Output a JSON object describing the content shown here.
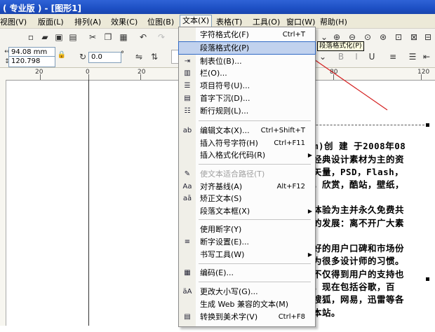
{
  "window": {
    "title": "( 专业版 ) - [图形1]"
  },
  "menubar": [
    {
      "label": "视图(V)"
    },
    {
      "label": "版面(L)"
    },
    {
      "label": "排列(A)"
    },
    {
      "label": "效果(C)"
    },
    {
      "label": "位图(B)"
    },
    {
      "label": "文本(X)"
    },
    {
      "label": "表格(T)"
    },
    {
      "label": "工具(O)"
    },
    {
      "label": "窗口(W)"
    },
    {
      "label": "帮助(H)"
    }
  ],
  "property_bar": {
    "x_value": "94.08 mm",
    "y_value": "120.798 mm",
    "rotation": "0.0",
    "degree_symbol": "°"
  },
  "ruler": {
    "labels": [
      "20",
      "0",
      "20",
      "40",
      "60",
      "80",
      "120"
    ]
  },
  "tooltip": "段落格式化(P)",
  "text_menu": {
    "items": [
      {
        "label": "字符格式化(F)",
        "shortcut": "Ctrl+T",
        "icon": "character-format-icon",
        "glyph": ""
      },
      {
        "label": "段落格式化(P)",
        "shortcut": "",
        "icon": "paragraph-format-icon",
        "glyph": "",
        "highlighted": true
      },
      {
        "label": "制表位(B)...",
        "shortcut": "",
        "icon": "tab-stops-icon",
        "glyph": "⇥"
      },
      {
        "label": "栏(O)...",
        "shortcut": "",
        "icon": "columns-icon",
        "glyph": "▥"
      },
      {
        "label": "项目符号(U)...",
        "shortcut": "",
        "icon": "bullets-icon",
        "glyph": "☰"
      },
      {
        "label": "首字下沉(D)...",
        "shortcut": "",
        "icon": "drop-cap-icon",
        "glyph": "▤"
      },
      {
        "label": "断行规则(L)...",
        "shortcut": "",
        "icon": "line-break-rules-icon",
        "glyph": "☷"
      },
      {
        "label": "编辑文本(X)...",
        "shortcut": "Ctrl+Shift+T",
        "icon": "edit-text-icon",
        "glyph": "ab",
        "sep_before": true
      },
      {
        "label": "插入符号字符(H)",
        "shortcut": "Ctrl+F11",
        "icon": "insert-symbol-icon",
        "glyph": ""
      },
      {
        "label": "插入格式化代码(R)",
        "shortcut": "",
        "icon": "",
        "glyph": "",
        "submenu": true
      },
      {
        "label": "使文本适合路径(T)",
        "shortcut": "",
        "icon": "fit-text-path-icon",
        "glyph": "✎",
        "disabled": true,
        "sep_before": true
      },
      {
        "label": "对齐基线(A)",
        "shortcut": "Alt+F12",
        "icon": "align-baseline-icon",
        "glyph": "Aa"
      },
      {
        "label": "矫正文本(S)",
        "shortcut": "",
        "icon": "straighten-text-icon",
        "glyph": "aā"
      },
      {
        "label": "段落文本框(X)",
        "shortcut": "",
        "icon": "",
        "glyph": "",
        "submenu": true
      },
      {
        "label": "使用断字(Y)",
        "shortcut": "",
        "icon": "",
        "glyph": "",
        "sep_before": true
      },
      {
        "label": "断字设置(E)...",
        "shortcut": "",
        "icon": "hyphenation-icon",
        "glyph": "≡"
      },
      {
        "label": "书写工具(W)",
        "shortcut": "",
        "icon": "",
        "glyph": "",
        "submenu": true
      },
      {
        "label": "编码(E)...",
        "shortcut": "",
        "icon": "encoding-icon",
        "glyph": "▦",
        "sep_before": true
      },
      {
        "label": "更改大小写(G)...",
        "shortcut": "",
        "icon": "change-case-icon",
        "glyph": "äA",
        "sep_before": true
      },
      {
        "label": "生成 Web 兼容的文本(M)",
        "shortcut": "",
        "icon": "",
        "glyph": ""
      },
      {
        "label": "转换到美术字(V)",
        "shortcut": "Ctrl+F8",
        "icon": "convert-artistic-icon",
        "glyph": "▤"
      }
    ]
  },
  "document_text": [
    "m)创 建 于2008年08",
    "经典设计素材为主的资",
    "矢量，PSD，Flash，",
    "，欣赏，酷站，壁纸，",
    "",
    "体验为主并永久免费共",
    "的发展：离不开广大素",
    "",
    "好的用户口碑和市场份",
    "为很多设计师的习惯。",
    "不仅得到用户的支持也",
    "，现在包括谷歌，百",
    "搜狐，网易，迅雷等各",
    "本站。"
  ]
}
